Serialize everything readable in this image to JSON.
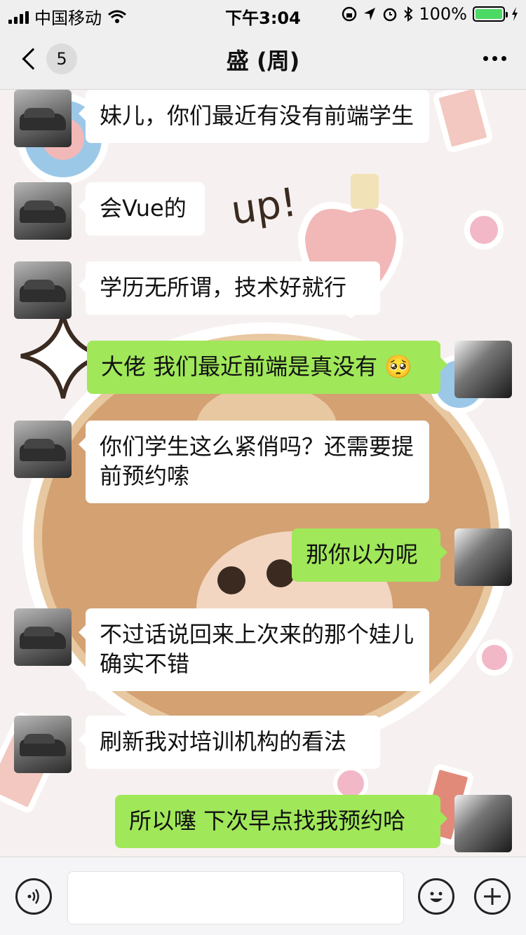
{
  "status_bar": {
    "carrier": "中国移动",
    "time": "下午3:04",
    "battery_percent": "100%"
  },
  "nav": {
    "unread_count": "5",
    "title": "盛  (周)"
  },
  "messages": [
    {
      "side": "left",
      "text": "妹儿，你们最近有没有前端学生"
    },
    {
      "side": "left",
      "text": "会Vue的"
    },
    {
      "side": "left",
      "text": "学历无所谓，技术好就行"
    },
    {
      "side": "right",
      "text": "大佬 我们最近前端是真没有 🥺"
    },
    {
      "side": "left",
      "text": "你们学生这么紧俏吗？还需要提前预约嗦"
    },
    {
      "side": "right",
      "text": "那你以为呢"
    },
    {
      "side": "left",
      "text": "不过话说回来上次来的那个娃儿确实不错"
    },
    {
      "side": "left",
      "text": "刷新我对培训机构的看法"
    },
    {
      "side": "right",
      "text": "所以噻 下次早点找我预约哈"
    }
  ],
  "wallpaper": {
    "sticker_text": "up!"
  },
  "colors": {
    "my_bubble": "#a0e75a",
    "their_bubble": "#ffffff",
    "wallpaper_bear": "#e8c8a0",
    "wallpaper_pink": "#f2b8b8",
    "wallpaper_blue": "#9cc8e8"
  },
  "input": {
    "placeholder": ""
  },
  "icons": [
    "signal-icon",
    "wifi-icon",
    "lock-rotation-icon",
    "location-icon",
    "alarm-icon",
    "bluetooth-icon",
    "battery-icon",
    "charging-icon",
    "back-chevron-icon",
    "more-icon",
    "voice-icon",
    "emoji-icon",
    "plus-icon"
  ]
}
